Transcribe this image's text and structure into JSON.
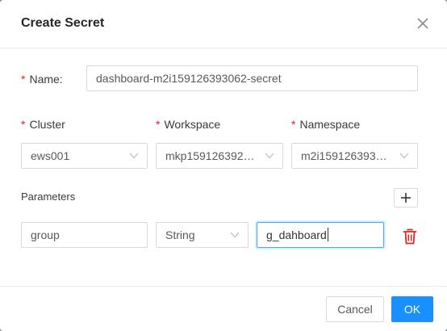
{
  "dialog": {
    "title": "Create Secret"
  },
  "form": {
    "name": {
      "label": "Name:",
      "required_mark": "*",
      "value": "dashboard-m2i159126393062-secret"
    },
    "cluster": {
      "label": "Cluster",
      "required_mark": "*",
      "value": "ews001"
    },
    "workspace": {
      "label": "Workspace",
      "required_mark": "*",
      "value": "mkp1591263929..."
    },
    "namespace": {
      "label": "Namespace",
      "required_mark": "*",
      "value": "m2i1591263930..."
    },
    "parameters": {
      "label": "Parameters",
      "rows": [
        {
          "key": "group",
          "type": "String",
          "value": "g_dahboard"
        }
      ]
    }
  },
  "footer": {
    "cancel_label": "Cancel",
    "ok_label": "OK"
  },
  "icons": {
    "close": "close-icon",
    "chevron": "chevron-down-icon",
    "add": "plus-icon",
    "delete": "trash-icon"
  },
  "colors": {
    "primary": "#1890ff",
    "required": "#e02424",
    "danger": "#e02424"
  }
}
